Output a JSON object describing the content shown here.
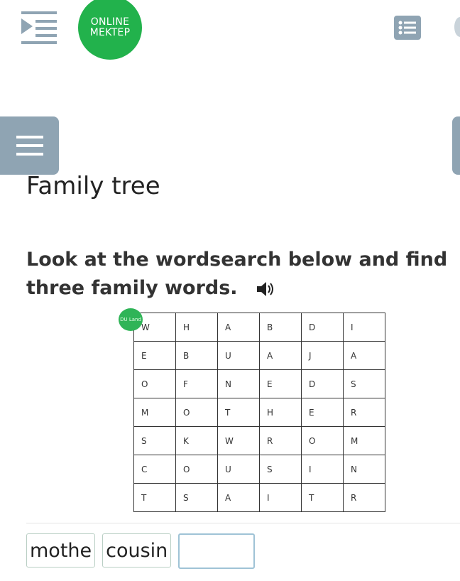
{
  "header": {
    "logo_line1": "ONLINE",
    "logo_line2": "MEKTEP",
    "menu_icon": "menu-collapse-icon",
    "list_icon": "list-icon"
  },
  "lesson": {
    "title": "Family tree",
    "instruction": "Look at the wordsearch below and find three family words."
  },
  "grid": {
    "badge": "DU\nLand",
    "rows": [
      [
        "W",
        "H",
        "A",
        "B",
        "D",
        "I"
      ],
      [
        "E",
        "B",
        "U",
        "A",
        "J",
        "A"
      ],
      [
        "O",
        "F",
        "N",
        "E",
        "D",
        "S"
      ],
      [
        "M",
        "O",
        "T",
        "H",
        "E",
        "R"
      ],
      [
        "S",
        "K",
        "W",
        "R",
        "O",
        "M"
      ],
      [
        "C",
        "O",
        "U",
        "S",
        "I",
        "N"
      ],
      [
        "T",
        "S",
        "A",
        "I",
        "T",
        "R"
      ]
    ]
  },
  "answers": {
    "filled": [
      "mothe",
      "cousin"
    ],
    "empty_value": ""
  },
  "colors": {
    "brand_green": "#22b24c",
    "button_gray": "#8fa4b3"
  }
}
